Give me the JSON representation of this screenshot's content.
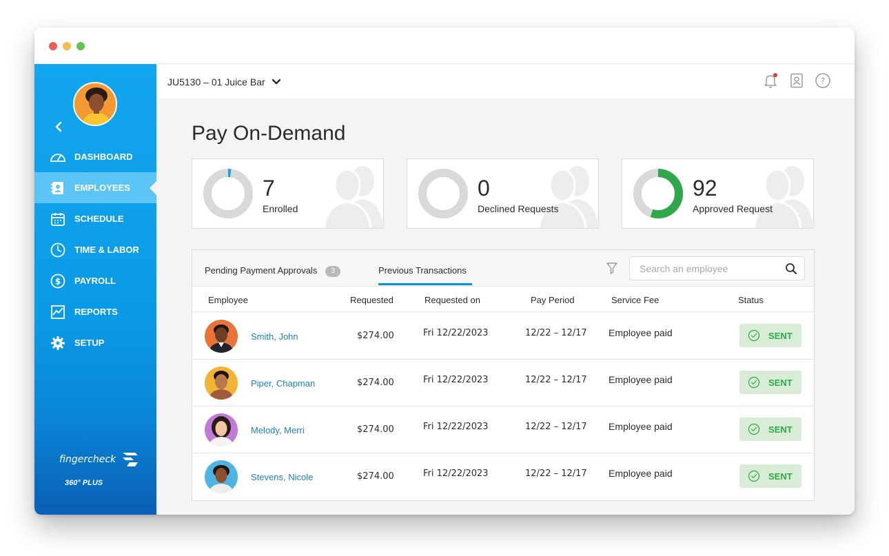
{
  "location": {
    "label": "JU5130 – 01 Juice Bar"
  },
  "sidebar": {
    "items": [
      {
        "label": "DASHBOARD",
        "icon": "gauge-icon"
      },
      {
        "label": "EMPLOYEES",
        "icon": "employee-card-icon",
        "active": true
      },
      {
        "label": "SCHEDULE",
        "icon": "calendar-icon"
      },
      {
        "label": "TIME & LABOR",
        "icon": "clock-icon"
      },
      {
        "label": "PAYROLL",
        "icon": "dollar-icon"
      },
      {
        "label": "REPORTS",
        "icon": "chart-icon"
      },
      {
        "label": "SETUP",
        "icon": "gear-icon"
      }
    ],
    "brand": {
      "name": "fingercheck",
      "sub": "360° PLUS"
    }
  },
  "page": {
    "title": "Pay On-Demand"
  },
  "stats": [
    {
      "value": "7",
      "label": "Enrolled",
      "fraction": 0.02,
      "color": "#1ba3ee"
    },
    {
      "value": "0",
      "label": "Declined Requests",
      "fraction": 0,
      "color": "#d9d9d9"
    },
    {
      "value": "92",
      "label": "Approved Request",
      "fraction": 0.55,
      "color": "#2ea84a"
    }
  ],
  "tabs": {
    "pending": {
      "label": "Pending Payment Approvals",
      "count": "3"
    },
    "previous": {
      "label": "Previous Transactions"
    }
  },
  "search": {
    "placeholder": "Search an employee"
  },
  "table": {
    "headers": {
      "employee": "Employee",
      "requested": "Requested",
      "requested_on": "Requested on",
      "pay_period": "Pay Period",
      "service_fee": "Service Fee",
      "status": "Status"
    },
    "rows": [
      {
        "name": "Smith, John",
        "amount": "$274.00",
        "date": "Fri 12/22/2023",
        "period": "12/22 – 12/17",
        "fee": "Employee paid",
        "status": "SENT"
      },
      {
        "name": "Piper, Chapman",
        "amount": "$274.00",
        "date": "Fri 12/22/2023",
        "period": "12/22 – 12/17",
        "fee": "Employee paid",
        "status": "SENT"
      },
      {
        "name": "Melody, Merri",
        "amount": "$274.00",
        "date": "Fri 12/22/2023",
        "period": "12/22 – 12/17",
        "fee": "Employee paid",
        "status": "SENT"
      },
      {
        "name": "Stevens, Nicole",
        "amount": "$274.00",
        "date": "Fri 12/22/2023",
        "period": "12/22 – 12/17",
        "fee": "Employee paid",
        "status": "SENT"
      }
    ]
  },
  "colors": {
    "sidebar": "#12a6ee",
    "accent": "#0d8fd8",
    "success": "#2ea84a"
  }
}
